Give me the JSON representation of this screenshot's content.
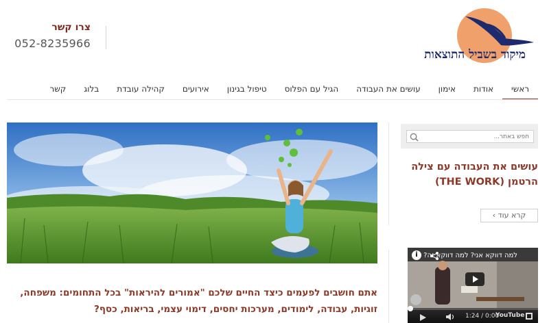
{
  "header": {
    "logo_text": "מיקוד בשביל התוצאות",
    "contact_title": "צרו קשר",
    "contact_phone": "052-8235966"
  },
  "nav": {
    "items": [
      {
        "label": "ראשי",
        "active": true
      },
      {
        "label": "אודות"
      },
      {
        "label": "אימון"
      },
      {
        "label": "עושים את העבודה"
      },
      {
        "label": "הגיל עם הפלוס"
      },
      {
        "label": "טיפול בגינון"
      },
      {
        "label": "אירועים"
      },
      {
        "label": "קהילה עובדת"
      },
      {
        "label": "בלוג"
      },
      {
        "label": "קשר"
      }
    ]
  },
  "main": {
    "intro_line1": "אתם חושבים לפעמים כיצד החיים שלכם \"אמורים להיראות\" בכל התחומים: משפחה,",
    "intro_line2": "זוגיות, עבודה, לימודים, מערכות יחסים, דימוי עצמי, בריאות, כסף?"
  },
  "sidebar": {
    "search_placeholder": "חפש באתר...",
    "heading_line1": "עושים את העבודה עם צילה",
    "heading_line2": "הרטמן (THE WORK)",
    "read_more": "קרא עוד ›"
  },
  "video": {
    "title": "למה דווקא אני? למה דווקא זה?",
    "info": "i",
    "time": "1:24 / 0:00",
    "brand": "YouTube",
    "progress": 0.0
  },
  "colors": {
    "accent": "#8b3a2a",
    "logo_navy": "#1e2a6e",
    "logo_orange": "#f0a06a"
  }
}
